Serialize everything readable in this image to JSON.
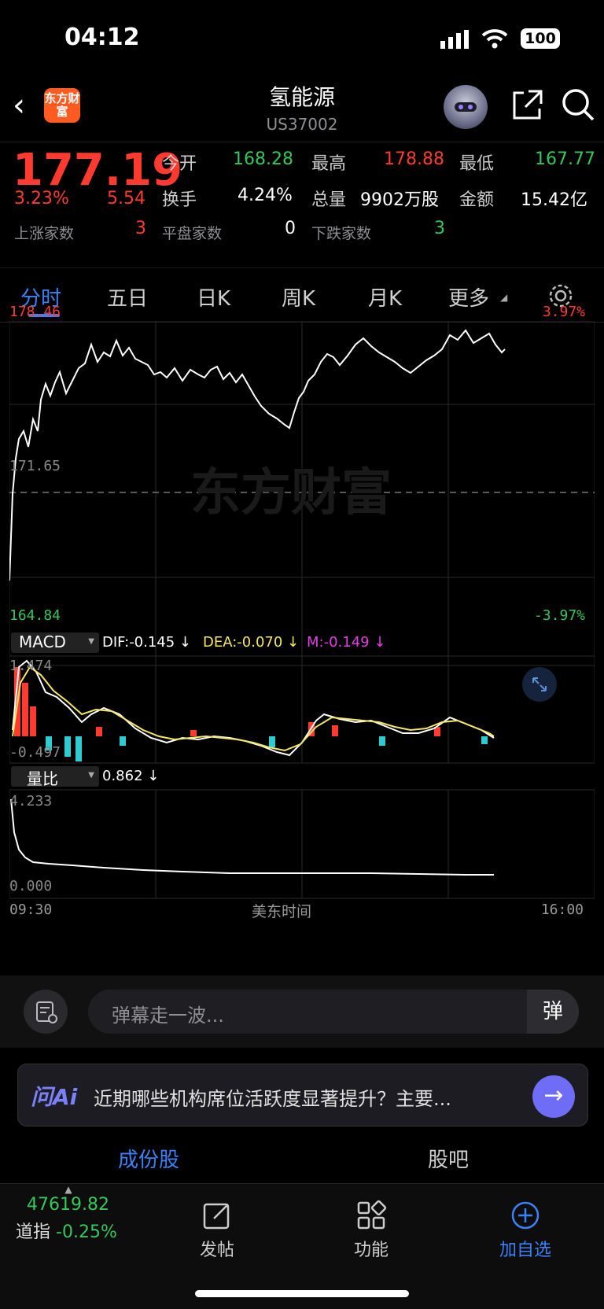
{
  "status_bar": {
    "time": "04:12",
    "battery": "100"
  },
  "header": {
    "title": "氢能源",
    "code": "US37002",
    "logo_text": "东方财富"
  },
  "quote": {
    "price": "177.19",
    "change_pct": "3.23%",
    "change": "5.54",
    "open_label": "今开",
    "open": "168.28",
    "high_label": "最高",
    "high": "178.88",
    "low_label": "最低",
    "low": "167.77",
    "turnover_label": "换手",
    "turnover": "4.24%",
    "volume_label": "总量",
    "volume": "9902万股",
    "amount_label": "金额",
    "amount": "15.42亿",
    "up_label": "上涨家数",
    "up_count": "3",
    "flat_label": "平盘家数",
    "flat_count": "0",
    "down_label": "下跌家数",
    "down_count": "3"
  },
  "tabs": [
    "分时",
    "五日",
    "日K",
    "周K",
    "月K",
    "更多"
  ],
  "chart": {
    "price_max": "178.46",
    "price_max_pct": "3.97%",
    "price_min": "164.84",
    "price_min_pct": "-3.97%",
    "prev_close": "171.65",
    "watermark": "东方财富",
    "macd_label": "MACD",
    "dif": "DIF:-0.145 ↓",
    "dea": "DEA:-0.070 ↓",
    "m": "M:-0.149 ↓",
    "macd_max": "1.474",
    "macd_min": "-0.497",
    "vr_label": "量比",
    "vr_value": "0.862 ↓",
    "vr_max": "4.233",
    "vr_min": "0.000",
    "time_start": "09:30",
    "time_mid": "美东时间",
    "time_end": "16:00"
  },
  "colors": {
    "up": "#ff3b30",
    "down": "#34c759",
    "accent": "#3b82f6"
  },
  "danmu": {
    "placeholder": "弹幕走一波...",
    "button": "弹"
  },
  "ai": {
    "logo": "问Ai",
    "text": "近期哪些机构席位活跃度显著提升？主要..."
  },
  "sections": [
    "成份股",
    "股吧"
  ],
  "bottom": {
    "index_value": "47619.82",
    "index_name": "道指",
    "index_change": "-0.25%",
    "post": "发帖",
    "func": "功能",
    "watch": "加自选"
  }
}
